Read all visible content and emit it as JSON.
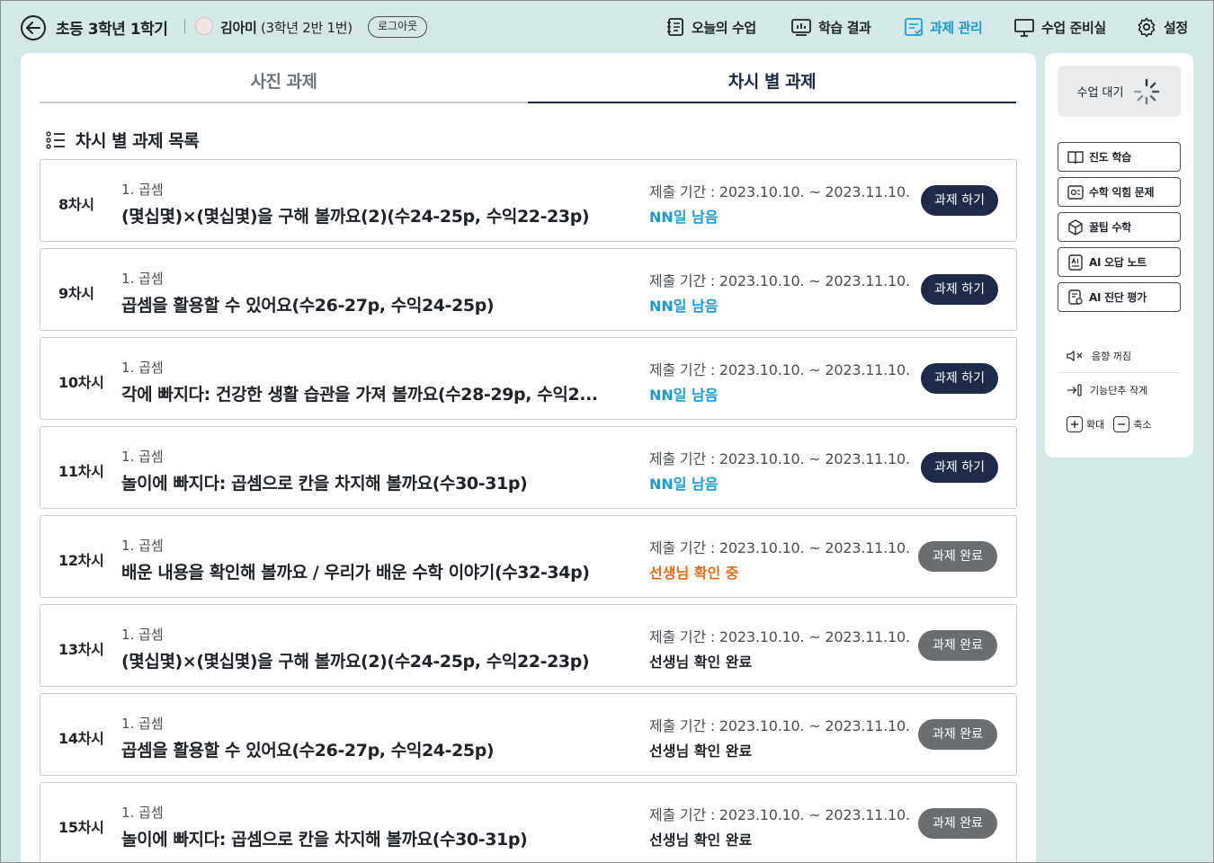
{
  "header": {
    "title": "초등 3학년 1학기",
    "user_name": "김아미",
    "user_info": "(3학년 2반 1번)",
    "logout_label": "로그아웃",
    "nav": [
      {
        "label": "오늘의 수업",
        "icon": "notebook-icon"
      },
      {
        "label": "학습 결과",
        "icon": "chart-result-icon"
      },
      {
        "label": "과제 관리",
        "icon": "task-manage-icon",
        "active": true
      },
      {
        "label": "수업 준비실",
        "icon": "board-icon"
      },
      {
        "label": "설정",
        "icon": "gear-icon"
      }
    ],
    "accent_color": "#1a9ad6"
  },
  "tabs": [
    {
      "label": "사진 과제",
      "active": false
    },
    {
      "label": "차시 별 과제",
      "active": true
    }
  ],
  "section_title": "차시 별 과제 목록",
  "assignments": [
    {
      "session": "8차시",
      "unit": "1. 곱셈",
      "title": "(몇십몇)×(몇십몇)을 구해 볼까요(2)(수24-25p, 수익22-23p)",
      "period": "제출 기간 : 2023.10.10. ~ 2023.11.10.",
      "status": "NN일 남음",
      "status_type": "remaining",
      "button": "과제 하기",
      "button_type": "todo"
    },
    {
      "session": "9차시",
      "unit": "1. 곱셈",
      "title": "곱셈을 활용할 수 있어요(수26-27p, 수익24-25p)",
      "period": "제출 기간 : 2023.10.10. ~ 2023.11.10.",
      "status": "NN일 남음",
      "status_type": "remaining",
      "button": "과제 하기",
      "button_type": "todo"
    },
    {
      "session": "10차시",
      "unit": "1. 곱셈",
      "title": "각에 빠지다: 건강한 생활 습관을 가져 볼까요(수28-29p, 수익2...",
      "period": "제출 기간 : 2023.10.10. ~ 2023.11.10.",
      "status": "NN일 남음",
      "status_type": "remaining",
      "button": "과제 하기",
      "button_type": "todo"
    },
    {
      "session": "11차시",
      "unit": "1. 곱셈",
      "title": "놀이에 빠지다: 곱셈으로 칸을 차지해 볼까요(수30-31p)",
      "period": "제출 기간 : 2023.10.10. ~ 2023.11.10.",
      "status": "NN일 남음",
      "status_type": "remaining",
      "button": "과제 하기",
      "button_type": "todo"
    },
    {
      "session": "12차시",
      "unit": "1. 곱셈",
      "title": "배운 내용을 확인해 볼까요 / 우리가 배운 수학 이야기(수32-34p)",
      "period": "제출 기간 : 2023.10.10. ~ 2023.11.10.",
      "status": "선생님 확인 중",
      "status_type": "checking",
      "button": "과제 완료",
      "button_type": "complete"
    },
    {
      "session": "13차시",
      "unit": "1. 곱셈",
      "title": "(몇십몇)×(몇십몇)을 구해 볼까요(2)(수24-25p, 수익22-23p)",
      "period": "제출 기간 : 2023.10.10. ~ 2023.11.10.",
      "status": "선생님 확인 완료",
      "status_type": "done",
      "button": "과제 완료",
      "button_type": "complete"
    },
    {
      "session": "14차시",
      "unit": "1. 곱셈",
      "title": "곱셈을 활용할 수 있어요(수26-27p, 수익24-25p)",
      "period": "제출 기간 : 2023.10.10. ~ 2023.11.10.",
      "status": "선생님 확인 완료",
      "status_type": "done",
      "button": "과제 완료",
      "button_type": "complete"
    },
    {
      "session": "15차시",
      "unit": "1. 곱셈",
      "title": "놀이에 빠지다: 곱셈으로 칸을 차지해 볼까요(수30-31p)",
      "period": "제출 기간 : 2023.10.10. ~ 2023.11.10.",
      "status": "선생님 확인 완료",
      "status_type": "done",
      "button": "과제 완료",
      "button_type": "complete"
    }
  ],
  "side": {
    "wait_label": "수업 대기",
    "menu": [
      {
        "label": "진도 학습",
        "icon": "book-open-icon"
      },
      {
        "label": "수학 익힘 문제",
        "icon": "workbook-icon"
      },
      {
        "label": "꿀팁 수학",
        "icon": "cube-icon"
      },
      {
        "label": "AI 오답 노트",
        "icon": "ai-note-icon"
      },
      {
        "label": "AI 진단 평가",
        "icon": "ai-eval-icon"
      }
    ],
    "tools": {
      "mute_label": "음향 꺼짐",
      "collapse_label": "기능단추 작게",
      "zoom_in_label": "확대",
      "zoom_out_label": "축소"
    }
  }
}
